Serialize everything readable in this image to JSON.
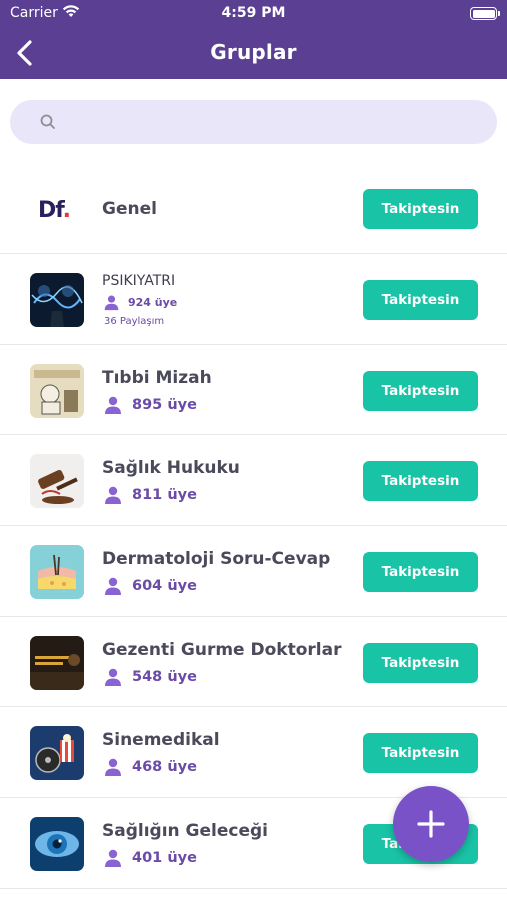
{
  "status_bar": {
    "carrier": "Carrier",
    "time": "4:59 PM"
  },
  "nav": {
    "title": "Gruplar",
    "back_icon": "chevron-left-icon"
  },
  "search": {
    "placeholder": "",
    "value": ""
  },
  "colors": {
    "header": "#5a3f93",
    "accent_purple": "#6a4ba5",
    "follow_button": "#19c3a6",
    "fab": "#7a52c7",
    "search_bg": "#e9e6f9"
  },
  "groups": [
    {
      "name": "Genel",
      "members": "",
      "shares": "",
      "button": "Takiptesin"
    },
    {
      "name": "PSIKIYATRI",
      "members": "924 üye",
      "shares": "36 Paylaşım",
      "button": "Takiptesin"
    },
    {
      "name": "Tıbbi Mizah",
      "members": "895 üye",
      "shares": "",
      "button": "Takiptesin"
    },
    {
      "name": "Sağlık Hukuku",
      "members": "811 üye",
      "shares": "",
      "button": "Takiptesin"
    },
    {
      "name": "Dermatoloji Soru-Cevap",
      "members": "604 üye",
      "shares": "",
      "button": "Takiptesin"
    },
    {
      "name": "Gezenti Gurme Doktorlar",
      "members": "548 üye",
      "shares": "",
      "button": "Takiptesin"
    },
    {
      "name": "Sinemedikal",
      "members": "468 üye",
      "shares": "",
      "button": "Takiptesin"
    },
    {
      "name": "Sağlığın Geleceği",
      "members": "401 üye",
      "shares": "",
      "button": "Takiptesin"
    }
  ],
  "logo": {
    "text": "Df",
    "dot": "."
  },
  "fab": {
    "icon": "plus-icon"
  }
}
